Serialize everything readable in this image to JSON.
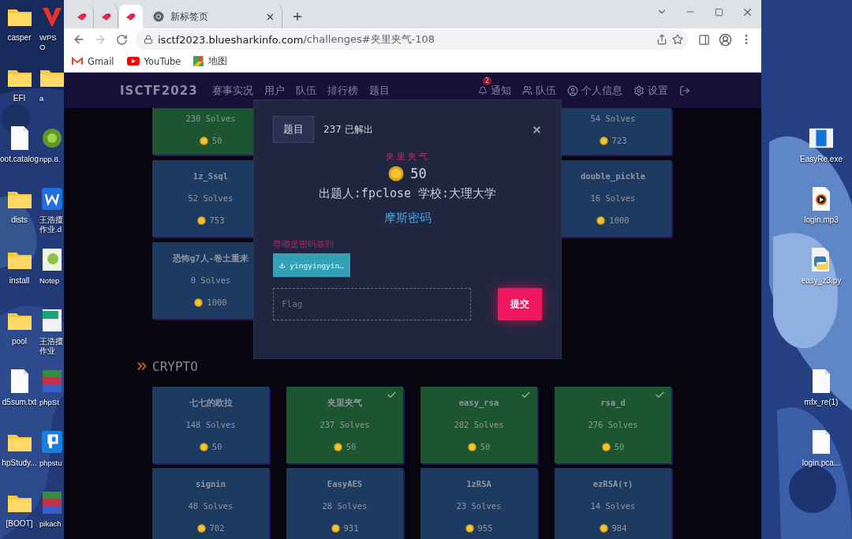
{
  "desktop": {
    "left_icons": [
      {
        "label": "casper",
        "kind": "folder"
      },
      {
        "label": "EFI",
        "kind": "folder"
      },
      {
        "label": "oot.catalog",
        "kind": "file"
      },
      {
        "label": "dists",
        "kind": "folder"
      },
      {
        "label": "install",
        "kind": "folder"
      },
      {
        "label": "pool",
        "kind": "folder"
      },
      {
        "label": "d5sum.txt",
        "kind": "file"
      },
      {
        "label": "hpStudy...",
        "kind": "folder"
      },
      {
        "label": "[BOOT]",
        "kind": "folder"
      }
    ],
    "partial_icons": [
      {
        "label": "WPS O",
        "kind": "wps"
      },
      {
        "label": "a",
        "kind": "folder"
      },
      {
        "label": "npp.8.",
        "kind": "app"
      },
      {
        "label": "王浩擅作业.d",
        "kind": "word"
      },
      {
        "label": "Notep",
        "kind": "notepad"
      },
      {
        "label": "王浩擅作业",
        "kind": "pdf"
      },
      {
        "label": "phpSt",
        "kind": "archive"
      },
      {
        "label": "phpstu",
        "kind": "php"
      },
      {
        "label": "pikach",
        "kind": "archive"
      }
    ],
    "right_icons": [
      {
        "label": "EasyRe.exe",
        "kind": "exe"
      },
      {
        "label": "login.mp3",
        "kind": "audio"
      },
      {
        "label": "easy_z3.py",
        "kind": "python"
      },
      {
        "label": "mfx_re(1)",
        "kind": "file"
      },
      {
        "label": "login.pca...",
        "kind": "file"
      }
    ]
  },
  "browser": {
    "tabs": [
      {
        "kind": "favicon",
        "selected": false
      },
      {
        "kind": "favicon",
        "selected": false
      },
      {
        "kind": "favicon",
        "selected": true
      },
      {
        "kind": "page",
        "label": "新标签页",
        "selected": false
      }
    ],
    "url_host": "isctf2023.bluesharkinfo.com",
    "url_path": "/challenges#夹里夹气-108",
    "bookmarks": [
      {
        "label": "Gmail",
        "kind": "gmail"
      },
      {
        "label": "YouTube",
        "kind": "youtube"
      },
      {
        "label": "地图",
        "kind": "maps"
      }
    ]
  },
  "site": {
    "logo": "ISCTF2023",
    "nav": [
      "赛事实况",
      "用户",
      "队伍",
      "排行榜",
      "题目"
    ],
    "right_nav": [
      {
        "kind": "notify",
        "label": "通知",
        "badge": "2"
      },
      {
        "kind": "team",
        "label": "队伍"
      },
      {
        "kind": "profile",
        "label": "个人信息"
      },
      {
        "kind": "settings",
        "label": "设置"
      },
      {
        "kind": "logout"
      }
    ]
  },
  "web_rows": [
    {
      "cards": [
        {
          "solves": "230 Solves",
          "points": "50",
          "solved": true
        },
        {
          "solves": "54 Solves",
          "points": "723",
          "solved": false
        }
      ]
    },
    {
      "cards": [
        {
          "name": "1z_Ssql",
          "solves": "52 Solves",
          "points": "753",
          "solved": false
        },
        {
          "name": "double_pickle",
          "solves": "16 Solves",
          "points": "1000",
          "solved": false
        }
      ]
    },
    {
      "cards": [
        {
          "name": "恐怖g7人-卷土重来",
          "solves": "0 Solves",
          "points": "1000",
          "solved": false
        }
      ]
    }
  ],
  "crypto": {
    "title": "CRYPTO",
    "cards": [
      {
        "name": "七七的欧拉",
        "solves": "148 Solves",
        "points": "50",
        "solved": false
      },
      {
        "name": "夹里夹气",
        "solves": "237 Solves",
        "points": "50",
        "solved": true
      },
      {
        "name": "easy_rsa",
        "solves": "282 Solves",
        "points": "50",
        "solved": true
      },
      {
        "name": "rsa_d",
        "solves": "276 Solves",
        "points": "50",
        "solved": true
      },
      {
        "name": "signin",
        "solves": "48 Solves",
        "points": "702",
        "solved": false
      },
      {
        "name": "EasyAES",
        "solves": "28 Solves",
        "points": "931",
        "solved": false
      },
      {
        "name": "1zRSA",
        "solves": "23 Solves",
        "points": "955",
        "solved": false
      },
      {
        "name": "ezRSA(τ)",
        "solves": "14 Solves",
        "points": "984",
        "solved": false
      }
    ]
  },
  "modal": {
    "tabs": [
      {
        "label": "题目",
        "selected": true
      }
    ],
    "solved_count": "237 已解出",
    "challenge_name": "夹里夹气",
    "points": "50",
    "author": "出题人:fpclose 学校:大理大学",
    "category": "摩斯密码",
    "description": "尊嘟是密码签到",
    "file": "yingyingyin…",
    "flag_placeholder": "Flag",
    "submit": "提交"
  }
}
